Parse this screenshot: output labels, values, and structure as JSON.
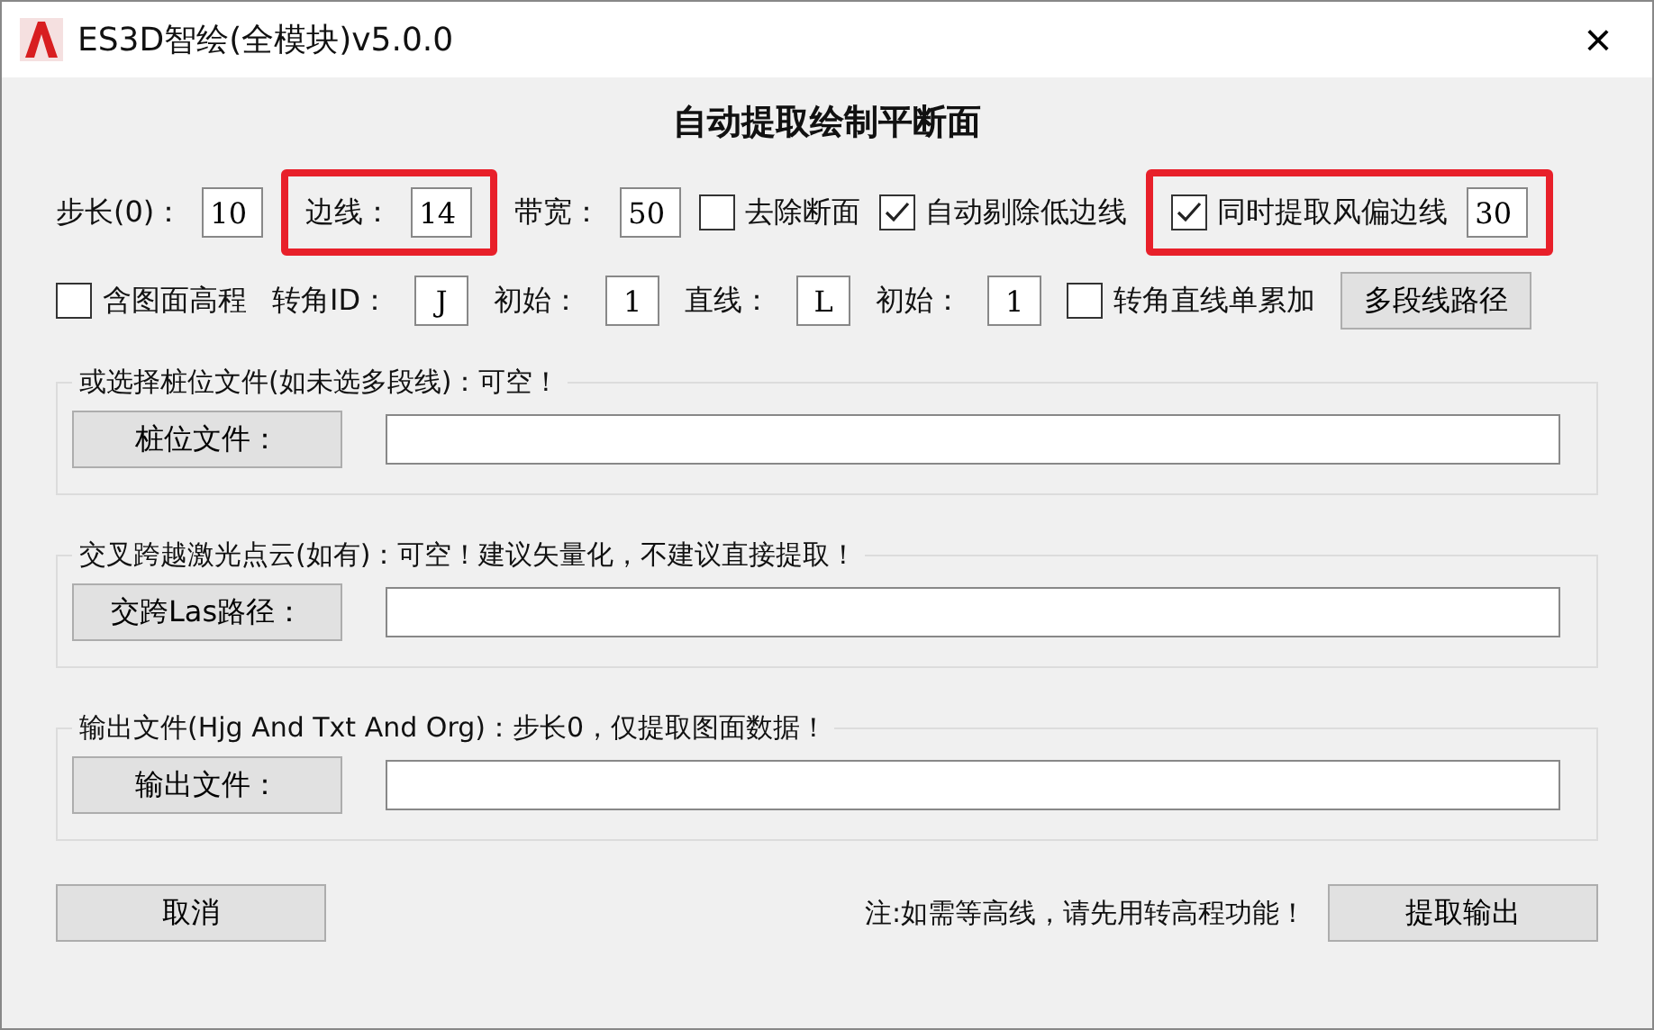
{
  "window": {
    "title": "ES3D智绘(全模块)v5.0.0",
    "close": "×"
  },
  "heading": "自动提取绘制平断面",
  "row_1": [
    {
      "highlighted": false,
      "items": [
        {
          "kind": "field",
          "label": "步长(0)：",
          "value": "10"
        }
      ]
    },
    {
      "highlighted": true,
      "items": [
        {
          "kind": "field",
          "label": "边线：",
          "value": "14"
        }
      ]
    },
    {
      "highlighted": false,
      "items": [
        {
          "kind": "field",
          "label": "带宽：",
          "value": "50"
        },
        {
          "kind": "checkbox",
          "label": "去除断面",
          "checked": false
        },
        {
          "kind": "checkbox",
          "label": "自动剔除低边线",
          "checked": true
        }
      ]
    },
    {
      "highlighted": true,
      "items": [
        {
          "kind": "checkbox",
          "label": "同时提取风偏边线",
          "checked": true
        },
        {
          "kind": "field",
          "value": "30"
        }
      ]
    }
  ],
  "row_2": [
    {
      "kind": "checkbox",
      "label": "含图面高程",
      "checked": false
    },
    {
      "kind": "field",
      "label": "转角ID：",
      "value": "J"
    },
    {
      "kind": "field",
      "label": "初始：",
      "value": "1"
    },
    {
      "kind": "field",
      "label": "直线：",
      "value": "L"
    },
    {
      "kind": "field",
      "label": "初始：",
      "value": "1"
    },
    {
      "kind": "checkbox",
      "label": "转角直线单累加",
      "checked": false
    },
    {
      "kind": "button",
      "label": "多段线路径"
    }
  ],
  "groups": [
    {
      "legend": "或选择桩位文件(如未选多段线)：可空！",
      "button": "桩位文件："
    },
    {
      "legend": "交叉跨越激光点云(如有)：可空！建议矢量化，不建议直接提取！",
      "button": "交跨Las路径："
    },
    {
      "legend": "输出文件(Hjg And Txt And Org)：步长0，仅提取图面数据！",
      "button": "输出文件："
    }
  ],
  "footer": {
    "cancel": "取消",
    "note": "注:如需等高线，请先用转高程功能！",
    "submit": "提取输出"
  }
}
